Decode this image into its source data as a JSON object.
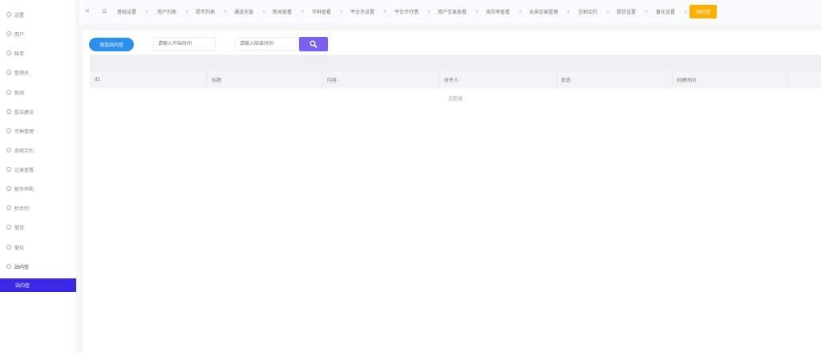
{
  "sidebar": {
    "items": [
      {
        "label": "设置",
        "icon": "gear-icon"
      },
      {
        "label": "用户",
        "icon": "user-icon"
      },
      {
        "label": "帐单",
        "icon": "bill-icon"
      },
      {
        "label": "管理员",
        "icon": "admin-icon"
      },
      {
        "label": "新闻",
        "icon": "news-icon"
      },
      {
        "label": "投诉建议",
        "icon": "feedback-icon"
      },
      {
        "label": "币种管理",
        "icon": "coin-icon"
      },
      {
        "label": "永续合约",
        "icon": "contract-icon"
      },
      {
        "label": "记录查看",
        "icon": "record-icon"
      },
      {
        "label": "新币申购",
        "icon": "newcoin-icon"
      },
      {
        "label": "秒合约",
        "icon": "seconds-icon"
      },
      {
        "label": "借贷",
        "icon": "loan-icon"
      },
      {
        "label": "量化",
        "icon": "quant-icon"
      },
      {
        "label": "站内信",
        "icon": "bell-icon"
      }
    ],
    "active_sub": "站内信"
  },
  "topbar": {
    "tabs": [
      "基础设置",
      "用户列表",
      "提币列表",
      "通道充值",
      "新闻查看",
      "币种查看",
      "平台币设置",
      "平台币行情",
      "用户交易查看",
      "风险率查看",
      "永续交易管理",
      "交割合约",
      "借贷设置",
      "量化设置",
      "站内信"
    ],
    "active_tab": "站内信"
  },
  "toolbar": {
    "add_label": "添加站内信",
    "start_placeholder": "请输入开始时间",
    "end_placeholder": "请输入结束时间"
  },
  "table": {
    "columns": [
      "ID",
      "标题",
      "内容",
      "收件人",
      "状态",
      "创建时间"
    ],
    "empty_text": "无数据"
  },
  "colors": {
    "accent_blue": "#2b8ff0",
    "active_tab": "#ffb000",
    "sidebar_active": "#3b27e8",
    "search_button": "#7b5ff2"
  }
}
